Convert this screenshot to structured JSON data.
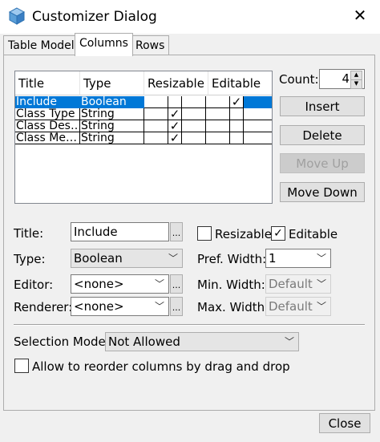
{
  "window": {
    "title": "Customizer Dialog",
    "close_glyph": "✕",
    "icon": "cube-icon"
  },
  "tabs": [
    {
      "label": "Table Model",
      "active": false
    },
    {
      "label": "Columns",
      "active": true
    },
    {
      "label": "Rows",
      "active": false
    }
  ],
  "table": {
    "headers": [
      "Title",
      "Type",
      "Resizable",
      "Editable"
    ],
    "rows": [
      {
        "title": "Include",
        "type": "Boolean",
        "resizable": "",
        "editable": "✓",
        "selected": true
      },
      {
        "title": "Class Type",
        "type": "String",
        "resizable": "✓",
        "editable": "",
        "selected": false
      },
      {
        "title": "Class Des…",
        "type": "String",
        "resizable": "✓",
        "editable": "",
        "selected": false
      },
      {
        "title": "Class Me…",
        "type": "String",
        "resizable": "✓",
        "editable": "",
        "selected": false
      }
    ]
  },
  "count": {
    "label": "Count:",
    "value": "4"
  },
  "buttons": {
    "insert": "Insert",
    "delete": "Delete",
    "move_up": "Move Up",
    "move_down": "Move Down",
    "close": "Close"
  },
  "form": {
    "title_label": "Title:",
    "title_value": "Include",
    "type_label": "Type:",
    "type_value": "Boolean",
    "editor_label": "Editor:",
    "editor_value": "<none>",
    "renderer_label": "Renderer:",
    "renderer_value": "<none>",
    "resizable_label": "Resizable",
    "resizable_checked": false,
    "editable_label": "Editable",
    "editable_checked": true,
    "pref_width_label": "Pref. Width:",
    "pref_width_value": "1",
    "min_width_label": "Min. Width:",
    "min_width_value": "Default",
    "max_width_label": "Max. Width:",
    "max_width_value": "Default",
    "dots": "...",
    "check_mark": "✓"
  },
  "selection": {
    "label": "Selection Model:",
    "value": "Not Allowed",
    "reorder_label": "Allow to reorder columns by drag and drop",
    "reorder_checked": false
  },
  "colors": {
    "selection": "#0078d7",
    "dialog_bg": "#f0f0f0"
  }
}
